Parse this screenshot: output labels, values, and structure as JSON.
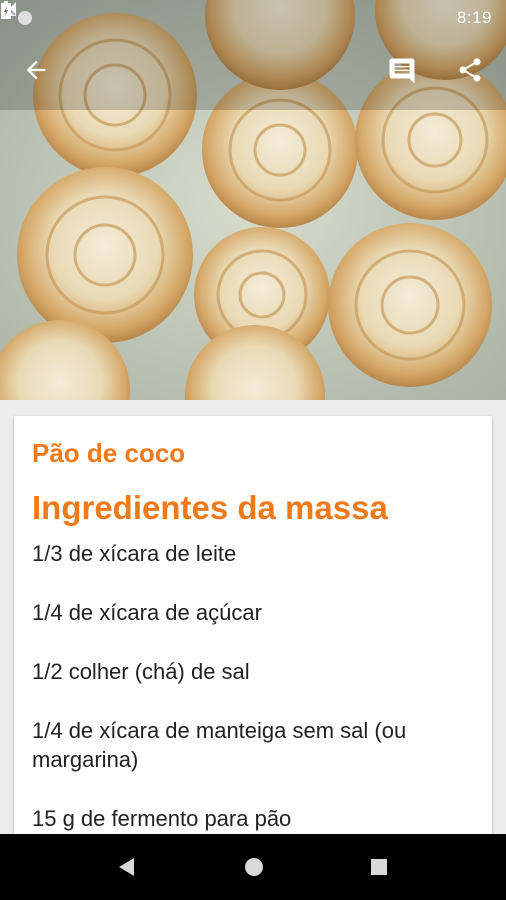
{
  "status_bar": {
    "time": "8:19",
    "icons": [
      "notification-dot",
      "signal-off-icon",
      "battery-charging-icon"
    ]
  },
  "app_bar": {
    "back_icon": "arrow-back-icon",
    "comment_icon": "comment-icon",
    "share_icon": "share-icon"
  },
  "hero": {
    "image_subject": "coconut bread rolls"
  },
  "recipe": {
    "title": "Pão de coco",
    "section_title": "Ingredientes da massa",
    "ingredients": [
      "1/3 de xícara de leite",
      "1/4 de xícara de açúcar",
      "1/2 colher (chá) de sal",
      "1/4 de xícara de manteiga sem sal (ou margarina)",
      "15 g de fermento para pão"
    ]
  },
  "nav_bar": {
    "back": "back-triangle-icon",
    "home": "home-circle-icon",
    "recents": "recents-square-icon"
  },
  "colors": {
    "accent": "#ef7a1b",
    "text": "#222222",
    "nav_background": "#000000"
  }
}
